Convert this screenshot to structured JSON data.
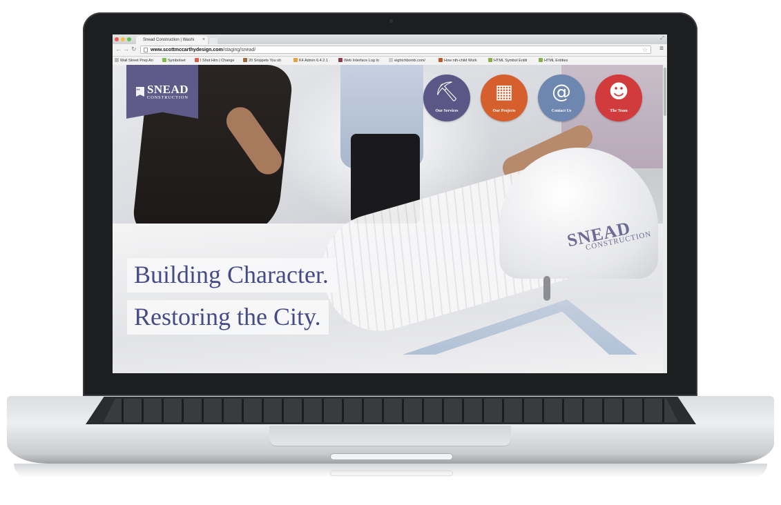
{
  "browser": {
    "tab_title": "Snead Construction | Washi",
    "tab_close": "×",
    "url_host": "www.scottmccarthydesign.com",
    "url_path": "/staging/snead/",
    "traffic_lights": [
      "#ee5b50",
      "#f3bf3d",
      "#5fc44d"
    ],
    "bookmarks": [
      {
        "label": "Wall Street Prep An",
        "color": "#bbbbbb"
      },
      {
        "label": "Symbolset",
        "color": "#7fc04a"
      },
      {
        "label": "I Shot Him | Change",
        "color": "#d6604d"
      },
      {
        "label": "20 Snippets You sh",
        "color": "#9a6a3a"
      },
      {
        "label": "K4 Admin 6.4.2.1",
        "color": "#e8a03a"
      },
      {
        "label": "Web Interface Log In",
        "color": "#8a3a4a"
      },
      {
        "label": "eightchbomb.com/",
        "color": "#cccccc"
      },
      {
        "label": "How nth-child Work",
        "color": "#c05a2a"
      },
      {
        "label": "HTML Symbol Entiti",
        "color": "#88b04a"
      },
      {
        "label": "HTML Entities",
        "color": "#88b04a"
      }
    ]
  },
  "site": {
    "logo": {
      "word": "SNEAD",
      "sub": "CONSTRUCTION"
    },
    "nav": [
      {
        "label": "Our Services",
        "icon": "wheelbarrow-icon",
        "glyph": "⛏",
        "color": "#5a5786"
      },
      {
        "label": "Our Projects",
        "icon": "building-icon",
        "glyph": "▦",
        "color": "#d5602e"
      },
      {
        "label": "Contact Us",
        "icon": "at-icon",
        "glyph": "@",
        "color": "#6e87b0"
      },
      {
        "label": "The Team",
        "icon": "worker-icon",
        "glyph": "☻",
        "color": "#d23b3b"
      }
    ],
    "headline_1": "Building Character.",
    "headline_2": "Restoring the City.",
    "helmet_logo": {
      "word": "SNEAD",
      "sub": "CONSTRUCTION"
    }
  }
}
